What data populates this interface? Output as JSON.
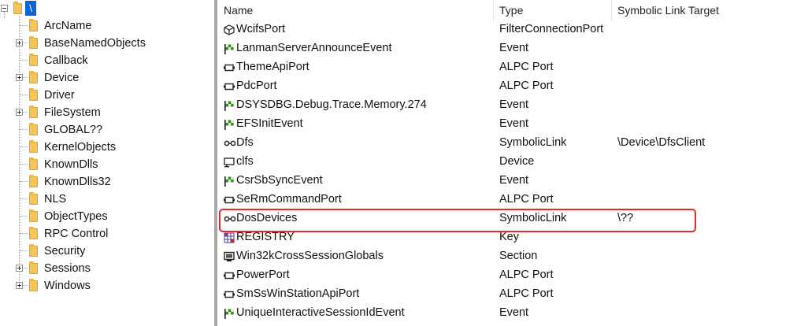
{
  "tree": {
    "root_label": "\\",
    "items": [
      {
        "label": "ArcName",
        "expandable": false
      },
      {
        "label": "BaseNamedObjects",
        "expandable": true
      },
      {
        "label": "Callback",
        "expandable": false
      },
      {
        "label": "Device",
        "expandable": true
      },
      {
        "label": "Driver",
        "expandable": false
      },
      {
        "label": "FileSystem",
        "expandable": true
      },
      {
        "label": "GLOBAL??",
        "expandable": false
      },
      {
        "label": "KernelObjects",
        "expandable": false
      },
      {
        "label": "KnownDlls",
        "expandable": false
      },
      {
        "label": "KnownDlls32",
        "expandable": false
      },
      {
        "label": "NLS",
        "expandable": false
      },
      {
        "label": "ObjectTypes",
        "expandable": false
      },
      {
        "label": "RPC Control",
        "expandable": false
      },
      {
        "label": "Security",
        "expandable": false
      },
      {
        "label": "Sessions",
        "expandable": true
      },
      {
        "label": "Windows",
        "expandable": true
      }
    ]
  },
  "list": {
    "columns": [
      "Name",
      "Type",
      "Symbolic Link Target"
    ],
    "rows": [
      {
        "name": "WcifsPort",
        "type": "FilterConnectionPort",
        "target": "",
        "icon": "cube-icon"
      },
      {
        "name": "LanmanServerAnnounceEvent",
        "type": "Event",
        "target": "",
        "icon": "flag-icon"
      },
      {
        "name": "ThemeApiPort",
        "type": "ALPC Port",
        "target": "",
        "icon": "port-icon"
      },
      {
        "name": "PdcPort",
        "type": "ALPC Port",
        "target": "",
        "icon": "port-icon"
      },
      {
        "name": "DSYSDBG.Debug.Trace.Memory.274",
        "type": "Event",
        "target": "",
        "icon": "flag-icon"
      },
      {
        "name": "EFSInitEvent",
        "type": "Event",
        "target": "",
        "icon": "flag-icon"
      },
      {
        "name": "Dfs",
        "type": "SymbolicLink",
        "target": "\\Device\\DfsClient",
        "icon": "link-icon"
      },
      {
        "name": "clfs",
        "type": "Device",
        "target": "",
        "icon": "device-icon"
      },
      {
        "name": "CsrSbSyncEvent",
        "type": "Event",
        "target": "",
        "icon": "flag-icon"
      },
      {
        "name": "SeRmCommandPort",
        "type": "ALPC Port",
        "target": "",
        "icon": "port-icon"
      },
      {
        "name": "DosDevices",
        "type": "SymbolicLink",
        "target": "\\??",
        "icon": "link-icon"
      },
      {
        "name": "REGISTRY",
        "type": "Key",
        "target": "",
        "icon": "key-grid-icon"
      },
      {
        "name": "Win32kCrossSessionGlobals",
        "type": "Section",
        "target": "",
        "icon": "section-icon"
      },
      {
        "name": "PowerPort",
        "type": "ALPC Port",
        "target": "",
        "icon": "port-icon"
      },
      {
        "name": "SmSsWinStationApiPort",
        "type": "ALPC Port",
        "target": "",
        "icon": "port-icon"
      },
      {
        "name": "UniqueInteractiveSessionIdEvent",
        "type": "Event",
        "target": "",
        "icon": "flag-icon"
      }
    ]
  },
  "colors": {
    "selection": "#0a64d6",
    "highlight_box": "#e8262c",
    "splitter": "#a8a8a8",
    "folder": "#f4c65a",
    "flag": "#2e8b1f"
  }
}
